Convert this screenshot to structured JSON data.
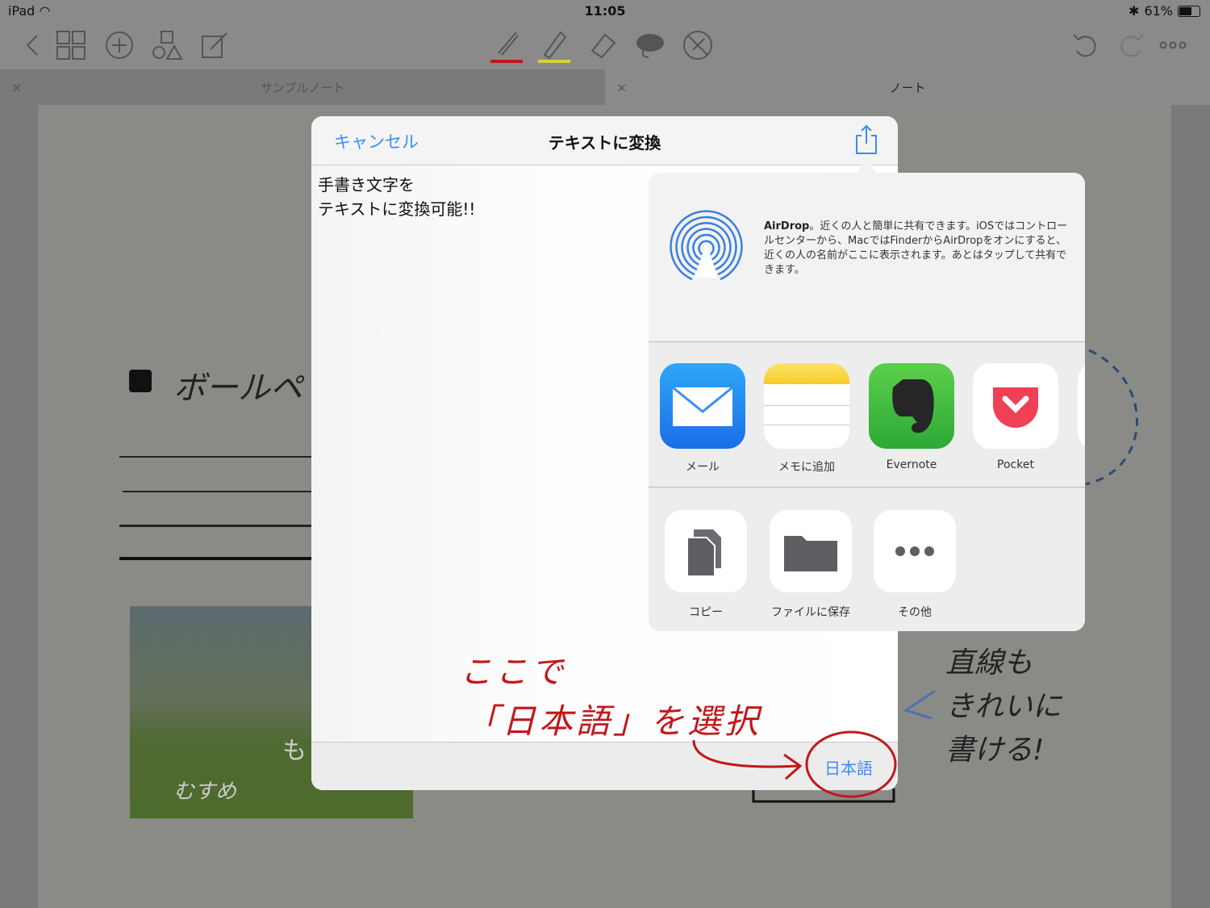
{
  "status_bar": {
    "device": "iPad",
    "time": "11:05",
    "battery": "61%"
  },
  "tabs": [
    {
      "label": "サンプルノート"
    },
    {
      "label": "ノート"
    }
  ],
  "modal": {
    "cancel_label": "キャンセル",
    "title": "テキストに変換",
    "text_line1": "手書き文字を",
    "text_line2": "テキストに変換可能!!",
    "language_label": "日本語"
  },
  "share_sheet": {
    "airdrop_title": "AirDrop",
    "airdrop_desc": "。近くの人と簡単に共有できます。iOSではコントロールセンターから、MacではFinderからAirDropをオンにすると、近くの人の名前がここに表示されます。あとはタップして共有できます。",
    "apps": [
      {
        "label": "メール",
        "icon": "mail-icon"
      },
      {
        "label": "メモに追加",
        "icon": "notes-icon"
      },
      {
        "label": "Evernote",
        "icon": "evernote-icon"
      },
      {
        "label": "Pocket",
        "icon": "pocket-icon"
      }
    ],
    "actions": [
      {
        "label": "コピー",
        "icon": "copy-icon"
      },
      {
        "label": "ファイルに保存",
        "icon": "folder-icon"
      },
      {
        "label": "その他",
        "icon": "more-icon"
      }
    ]
  },
  "annotations": {
    "line1": "ここで",
    "line2": "「日本語」を選択",
    "side_line1": "直線も",
    "side_line2": "きれいに",
    "side_line3": "書ける!",
    "heading": "ボールペ",
    "photo_caption": "むすめ",
    "photo_caption2": "も"
  },
  "colors": {
    "accent": "#3a8ef3",
    "annotation_red": "#c2171a",
    "pen_red": "#c2171a",
    "pen_yellow": "#d8d23a"
  }
}
